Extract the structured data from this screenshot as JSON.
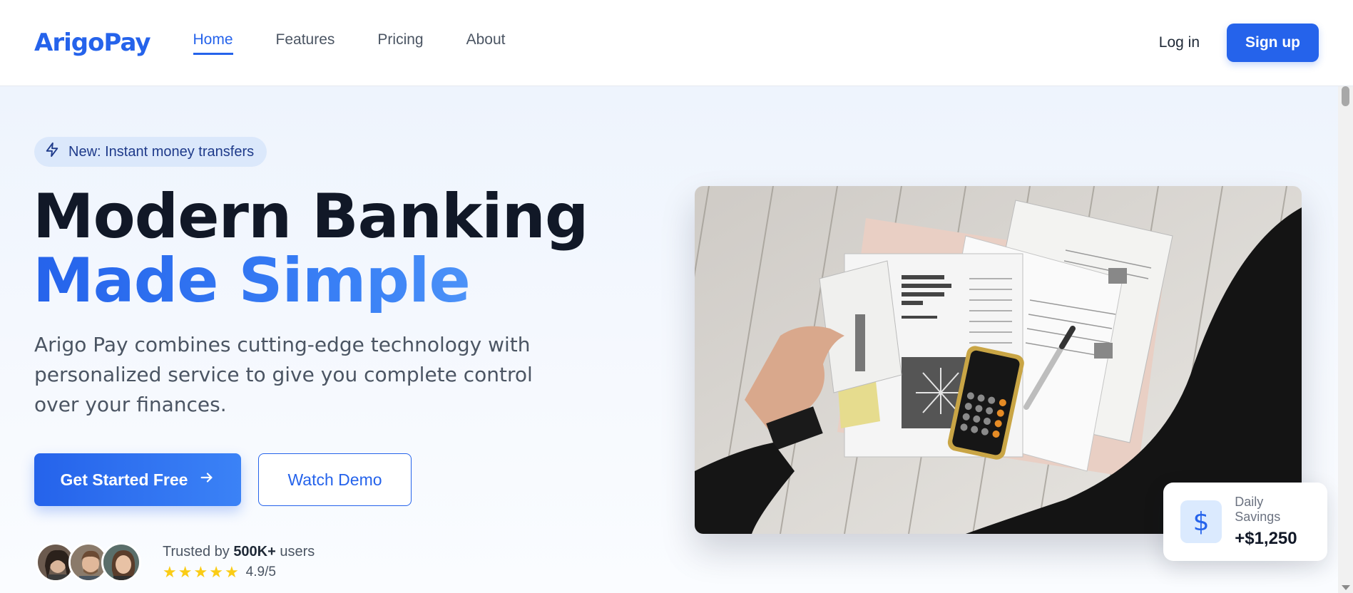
{
  "nav": {
    "logo": "ArigoPay",
    "links": [
      {
        "label": "Home",
        "active": true
      },
      {
        "label": "Features",
        "active": false
      },
      {
        "label": "Pricing",
        "active": false
      },
      {
        "label": "About",
        "active": false
      }
    ],
    "login_label": "Log in",
    "signup_label": "Sign up"
  },
  "hero": {
    "badge_icon": "lightning-icon",
    "badge_text": "New: Instant money transfers",
    "headline_line1": "Modern Banking",
    "headline_line2": "Made Simple",
    "description": "Arigo Pay combines cutting-edge technology with personalized service to give you complete control over your finances.",
    "primary_button": "Get Started Free",
    "secondary_button": "Watch Demo",
    "trust_prefix": "Trusted by",
    "trust_count": "500K+",
    "trust_suffix": "users",
    "rating_stars": 5,
    "rating_value": "4.9/5"
  },
  "savings_card": {
    "icon": "dollar-icon",
    "label": "Daily Savings",
    "value": "+$1,250"
  },
  "colors": {
    "accent": "#2563eb",
    "accent_light": "#3b82f6",
    "badge_bg": "#dbe8fb",
    "star": "#facc15"
  }
}
